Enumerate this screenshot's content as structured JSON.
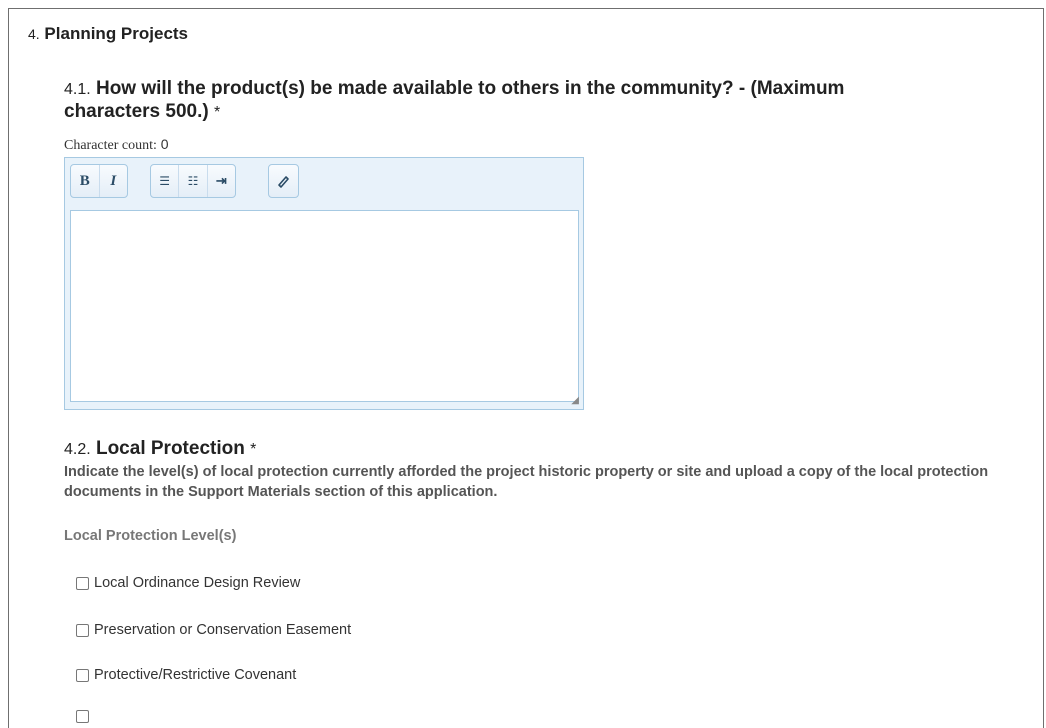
{
  "section": {
    "number": "4.",
    "title": "Planning Projects"
  },
  "question1": {
    "number": "4.1.",
    "text_line1": "How will the product(s) be made available to others in the community? - (Maximum",
    "text_line2": "characters 500.)",
    "required_mark": "*",
    "char_count_label": "Character count:",
    "char_count_value": "0",
    "editor_value": ""
  },
  "toolbar": {
    "bold": "B",
    "italic": "I",
    "bullets": "☰",
    "numbered": "☷",
    "indent": "⇥",
    "eraser": "⌫"
  },
  "question2": {
    "number": "4.2.",
    "text": "Local Protection",
    "required_mark": "*",
    "description": "Indicate the level(s) of local protection currently afforded the project historic property or site and upload a copy of the local protection documents in the Support Materials section of this application.",
    "group_label": "Local Protection Level(s)",
    "options": [
      {
        "label": "Local Ordinance Design Review",
        "checked": false
      },
      {
        "label": "Preservation or Conservation Easement",
        "checked": false
      },
      {
        "label": "Protective/Restrictive Covenant",
        "checked": false
      },
      {
        "label": "",
        "checked": false
      }
    ]
  }
}
